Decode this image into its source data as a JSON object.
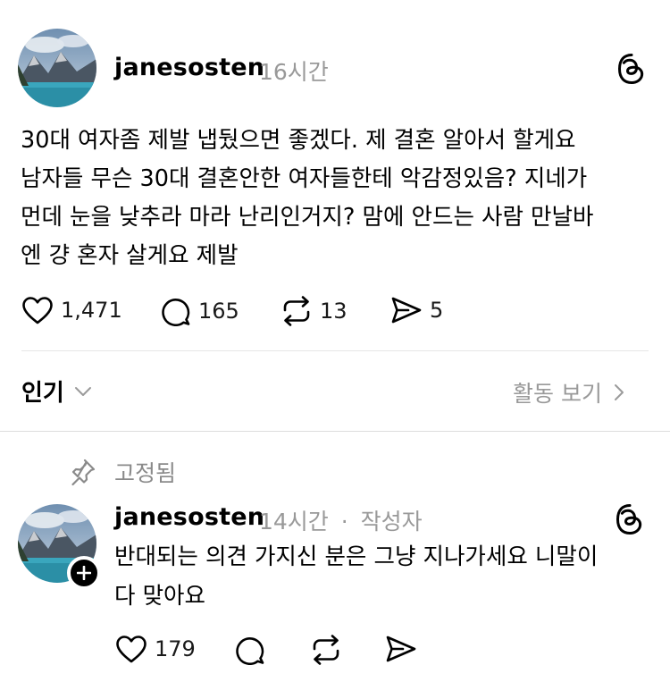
{
  "post": {
    "username": "janesosten",
    "time": "16시간",
    "body_lines": [
      "30대 여자좀 제발 냅뒀으면 좋겠다. 제 결혼 알아서 할게요",
      "남자들 무슨 30대 결혼안한 여자들한테 악감정있음? 지네가",
      "먼데 눈을 낮추라 마라 난리인거지? 맘에 안드는 사람 만날바",
      "엔 걍 혼자 살게요 제발"
    ],
    "likes": "1,471",
    "replies": "165",
    "reposts": "13",
    "shares": "5",
    "icons": {
      "threads": "threads-logo-icon",
      "like": "heart-icon",
      "reply": "comment-bubble-icon",
      "repost": "repost-icon",
      "share": "send-icon"
    }
  },
  "sort_bar": {
    "sort_label": "인기",
    "activity_label": "활동 보기"
  },
  "reply": {
    "pinned_label": "고정됨",
    "username": "janesosten",
    "time": "14시간",
    "separator": "·",
    "author_tag": "작성자",
    "body_lines": [
      "반대되는 의견 가지신 분은 그냥 지나가세요 니말이",
      "다 맞아요"
    ],
    "likes": "179"
  },
  "colors": {
    "text": "#000000",
    "muted": "#999999",
    "divider": "#e6e6e6"
  }
}
